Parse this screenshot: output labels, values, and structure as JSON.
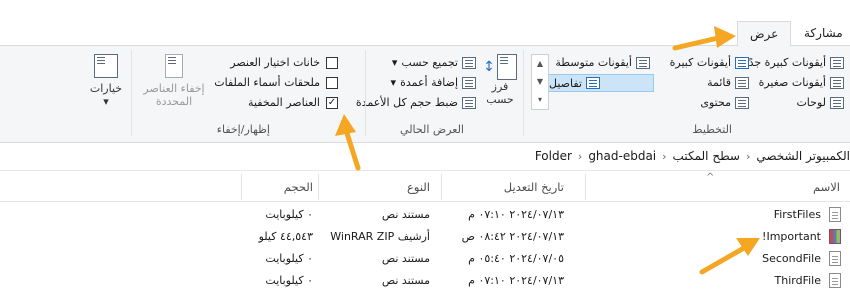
{
  "tabs": [
    {
      "label": "مشاركة"
    },
    {
      "label": "عرض"
    }
  ],
  "ribbon": {
    "layout": {
      "group_label": "التخطيط",
      "items": [
        {
          "label": "أيقونات كبيرة جدًا"
        },
        {
          "label": "أيقونات كبيرة"
        },
        {
          "label": "أيقونات متوسطة"
        },
        {
          "label": "أيقونات صغيرة"
        },
        {
          "label": "قائمة"
        },
        {
          "label": "تفاصيل"
        },
        {
          "label": "لوحات"
        },
        {
          "label": "محتوى"
        }
      ]
    },
    "current_view": {
      "group_label": "العرض الحالي",
      "sort_label": "فرز",
      "sort_label2": "حسب",
      "items": [
        {
          "label": "تجميع حسب"
        },
        {
          "label": "إضافة أعمدة"
        },
        {
          "label": "ضبط حجم كل الأعمدة"
        }
      ]
    },
    "show_hide": {
      "group_label": "إظهار/إخفاء",
      "checkboxes": [
        {
          "label": "خانات اختيار العنصر",
          "checked": false
        },
        {
          "label": "ملحقات أسماء الملفات",
          "checked": false
        },
        {
          "label": "العناصر المخفية",
          "checked": true
        }
      ],
      "hide_selected": "إخفاء العناصر المحددة",
      "hide_selected_1": "إخفاء العناصر",
      "hide_selected_2": "المحددة",
      "options": "خيارات"
    }
  },
  "breadcrumb": [
    "الكمبيوتر الشخصي",
    "سطح المكتب",
    "ghad-ebdai",
    "Folder"
  ],
  "columns": {
    "name": "الاسم",
    "date": "تاريخ التعديل",
    "type": "النوع",
    "size": "الحجم"
  },
  "files": [
    {
      "name": "FirstFiles",
      "date": "٢٠٢٤/٠٧/١٣ ٠٧:١٠ م",
      "type": "مستند نص",
      "size": "٠ كيلوبايت",
      "icon": "text-file-icon"
    },
    {
      "name": "Important!",
      "date": "٢٠٢٤/٠٧/١٣ ٠٨:٤٢ ص",
      "type": "أرشيف WinRAR ZIP",
      "size": "٤٤,٥٤٣ كيلو",
      "icon": "zip-archive-icon"
    },
    {
      "name": "SecondFile",
      "date": "٢٠٢٤/٠٧/٠٥ ٠٥:٤٠ م",
      "type": "مستند نص",
      "size": "٠ كيلوبايت",
      "icon": "text-file-icon"
    },
    {
      "name": "ThirdFile",
      "date": "٢٠٢٤/٠٧/١٣ ٠٧:١٠ م",
      "type": "مستند نص",
      "size": "٠ كيلوبايت",
      "icon": "text-file-icon"
    }
  ],
  "colors": {
    "accent": "#f5a623",
    "selection": "#cce4f7"
  }
}
